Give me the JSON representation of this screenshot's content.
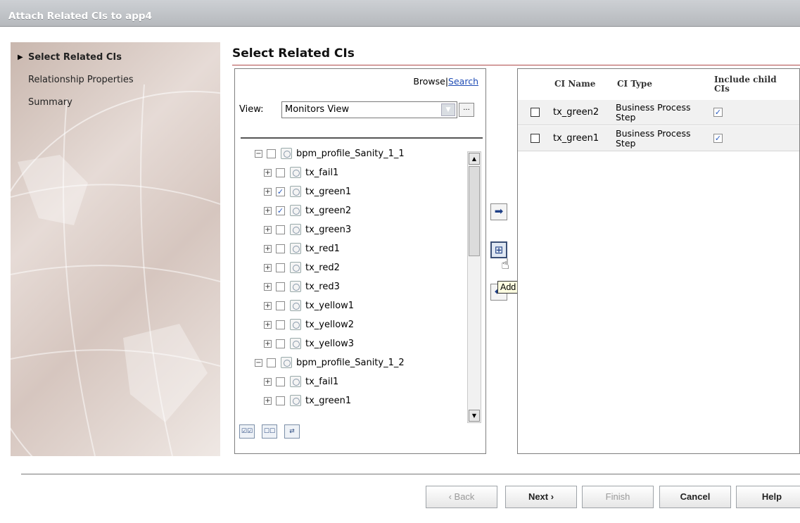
{
  "window": {
    "title": "Attach Related CIs to app4"
  },
  "steps": [
    {
      "label": "Select Related CIs",
      "active": true
    },
    {
      "label": "Relationship Properties",
      "active": false
    },
    {
      "label": "Summary",
      "active": false
    }
  ],
  "main": {
    "heading": "Select Related CIs"
  },
  "browse": {
    "browse_label": "Browse",
    "separator": "|",
    "search_label": "Search"
  },
  "view": {
    "label": "View:",
    "selected": "Monitors View",
    "dots": "..."
  },
  "tree": [
    {
      "label": "bpm_profile_Sanity_1_1",
      "level": 0,
      "expander": "−",
      "checked": false
    },
    {
      "label": "tx_fail1",
      "level": 1,
      "expander": "+",
      "checked": false
    },
    {
      "label": "tx_green1",
      "level": 1,
      "expander": "+",
      "checked": true
    },
    {
      "label": "tx_green2",
      "level": 1,
      "expander": "+",
      "checked": true
    },
    {
      "label": "tx_green3",
      "level": 1,
      "expander": "+",
      "checked": false
    },
    {
      "label": "tx_red1",
      "level": 1,
      "expander": "+",
      "checked": false
    },
    {
      "label": "tx_red2",
      "level": 1,
      "expander": "+",
      "checked": false
    },
    {
      "label": "tx_red3",
      "level": 1,
      "expander": "+",
      "checked": false
    },
    {
      "label": "tx_yellow1",
      "level": 1,
      "expander": "+",
      "checked": false
    },
    {
      "label": "tx_yellow2",
      "level": 1,
      "expander": "+",
      "checked": false
    },
    {
      "label": "tx_yellow3",
      "level": 1,
      "expander": "+",
      "checked": false
    },
    {
      "label": "bpm_profile_Sanity_1_2",
      "level": 0,
      "expander": "−",
      "checked": false
    },
    {
      "label": "tx_fail1",
      "level": 1,
      "expander": "+",
      "checked": false
    },
    {
      "label": "tx_green1",
      "level": 1,
      "expander": "+",
      "checked": false
    }
  ],
  "middle": {
    "add_icon": "arrow-right-icon",
    "add_children_icon": "add-children-icon",
    "remove_icon": "arrow-left-icon",
    "tooltip": "Add CIs and their Children"
  },
  "table": {
    "columns": [
      "CI Name",
      "CI Type",
      "Include child CIs"
    ],
    "rows": [
      {
        "name": "tx_green2",
        "type": "Business Process Step",
        "include": true
      },
      {
        "name": "tx_green1",
        "type": "Business Process Step",
        "include": true
      }
    ]
  },
  "footer": {
    "back": "‹ Back",
    "next": "Next ›",
    "finish": "Finish",
    "cancel": "Cancel",
    "help": "Help"
  },
  "colors": {
    "heading_rule": "#b04a4a",
    "link": "#1f4cb5",
    "tooltip_bg": "#ffffe1"
  }
}
